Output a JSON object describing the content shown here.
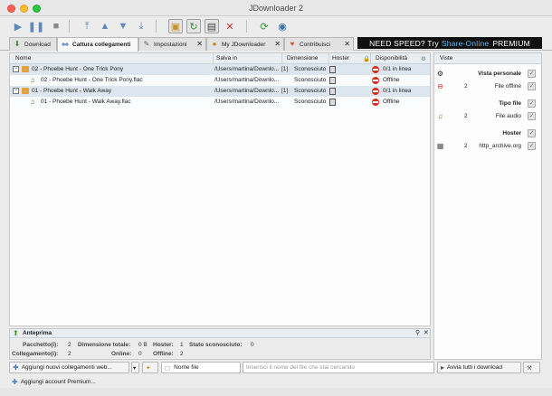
{
  "window": {
    "title": "JDownloader 2"
  },
  "tabs": [
    {
      "label": "Download",
      "icon": "download-arrow-icon"
    },
    {
      "label": "Cattura collegamenti",
      "icon": "linkgrabber-icon",
      "active": true
    },
    {
      "label": "Impostazioni",
      "icon": "settings-icon"
    },
    {
      "label": "My JDownloader",
      "icon": "myjd-icon"
    },
    {
      "label": "Contribuisci",
      "icon": "heart-icon"
    }
  ],
  "banner": {
    "text1": "NEED SPEED? Try",
    "text2": "Share-Online",
    "text3": "PREMIUM"
  },
  "table": {
    "columns": {
      "name": "Nome",
      "save": "Salva in",
      "size": "Dimensione",
      "hoster": "Hoster",
      "avail": "Disponibilità"
    },
    "rows": [
      {
        "type": "package",
        "name": "02 - Phoebe Hunt - One Trick Pony",
        "save": "/Users/martina/Downlo...",
        "count": "[1]",
        "size": "Sconosciuto",
        "avail": "0/1 in linea"
      },
      {
        "type": "file",
        "name": "02 - Phoebe Hunt - One Trick Pony.flac",
        "save": "/Users/martina/Downlo...",
        "size": "Sconosciuto",
        "avail": "Offline"
      },
      {
        "type": "package",
        "name": "01 - Phoebe Hunt - Walk Away",
        "save": "/Users/martina/Downlo...",
        "count": "[1]",
        "size": "Sconosciuto",
        "avail": "0/1 in linea"
      },
      {
        "type": "file",
        "name": "01 - Phoebe Hunt - Walk Away.flac",
        "save": "/Users/martina/Downlo...",
        "size": "Sconosciuto",
        "avail": "Offline"
      }
    ]
  },
  "side": {
    "header": "Viste",
    "sections": [
      {
        "title": "Vista personale",
        "items": [
          {
            "count": "2",
            "label": "File offline"
          }
        ]
      },
      {
        "title": "Tipo file",
        "items": [
          {
            "count": "2",
            "label": "File audio"
          }
        ]
      },
      {
        "title": "Hoster",
        "items": [
          {
            "count": "2",
            "label": "http_archive.org"
          }
        ]
      }
    ]
  },
  "preview": {
    "title": "Anteprima",
    "packages_label": "Pacchetto(i):",
    "packages": "2",
    "total_size_label": "Dimensione totale:",
    "total_size": "0 B",
    "hoster_label": "Hoster:",
    "hoster": "1",
    "unknown_state_label": "Stato sconosciuto:",
    "unknown_state": "0",
    "links_label": "Collegamento(i):",
    "links": "2",
    "online_label": "Online:",
    "online": "0",
    "offline_label": "Offline:",
    "offline": "2"
  },
  "bottom": {
    "add_links": "Aggiungi nuovi collegamenti web...",
    "filter_field": "Nome file",
    "search_placeholder": "Inserisci il nome del file che stai cercando",
    "start_all": "Avvia tutti i download",
    "add_account": "Aggiungi account Premium..."
  }
}
